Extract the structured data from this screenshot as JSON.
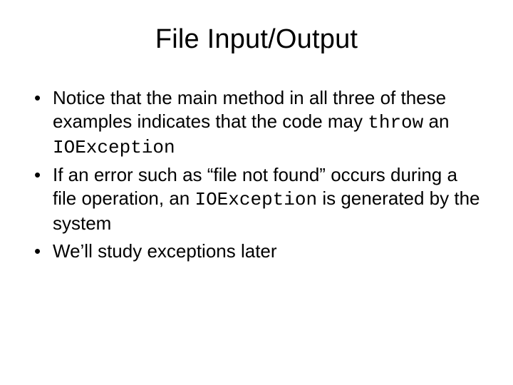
{
  "title": "File Input/Output",
  "bullets": [
    {
      "runs": [
        {
          "t": "Notice that the main method in all three of these examples indicates that the code may "
        },
        {
          "t": "throw",
          "mono": true
        },
        {
          "t": " an "
        },
        {
          "t": "IOException",
          "mono": true
        }
      ]
    },
    {
      "runs": [
        {
          "t": "If an error such as “file not found” occurs during a file operation, an "
        },
        {
          "t": "IOException",
          "mono": true
        },
        {
          "t": " is generated by the system"
        }
      ]
    },
    {
      "runs": [
        {
          "t": "We’ll study exceptions later"
        }
      ]
    }
  ]
}
